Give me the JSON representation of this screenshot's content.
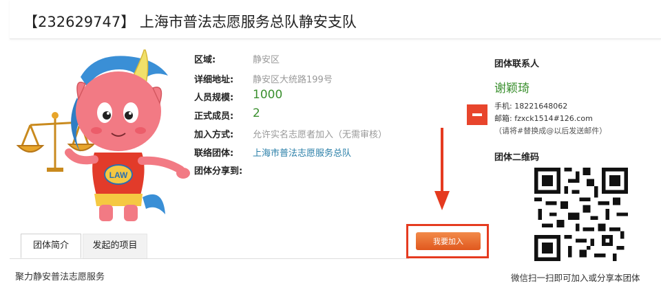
{
  "header": {
    "title": "【232629747】 上海市普法志愿服务总队静安支队"
  },
  "info": {
    "region": {
      "label": "区域:",
      "value": "静安区"
    },
    "address": {
      "label": "详细地址:",
      "value": "静安区大统路199号"
    },
    "size": {
      "label": "人员规模:",
      "value": "1000"
    },
    "members": {
      "label": "正式成员:",
      "value": "2"
    },
    "join_method": {
      "label": "加入方式:",
      "value": "允许实名志愿者加入（无需审核）"
    },
    "linked_group": {
      "label": "联络团体:",
      "value": "上海市普法志愿服务总队"
    },
    "share": {
      "label": "团体分享到:"
    }
  },
  "contact": {
    "heading": "团体联系人",
    "name": "谢颖琦",
    "phone": "手机: 18221648062",
    "email": "邮箱: fzxck1514#126.com",
    "note": "（请将#替换成@以后发送邮件）"
  },
  "qr": {
    "heading": "团体二维码",
    "caption": "微信扫一扫即可加入或分享本团体"
  },
  "mascot": {
    "badge": "LAW"
  },
  "join_button": {
    "label": "我要加入"
  },
  "tabs": [
    {
      "label": "团体简介"
    },
    {
      "label": "发起的项目"
    }
  ],
  "intro": {
    "text": "聚力静安普法志愿服务"
  },
  "colors": {
    "accent_green": "#3a8f2e",
    "link_blue": "#2a7fa8",
    "highlight_red": "#e53a1f",
    "button_orange": "#e0581e"
  }
}
